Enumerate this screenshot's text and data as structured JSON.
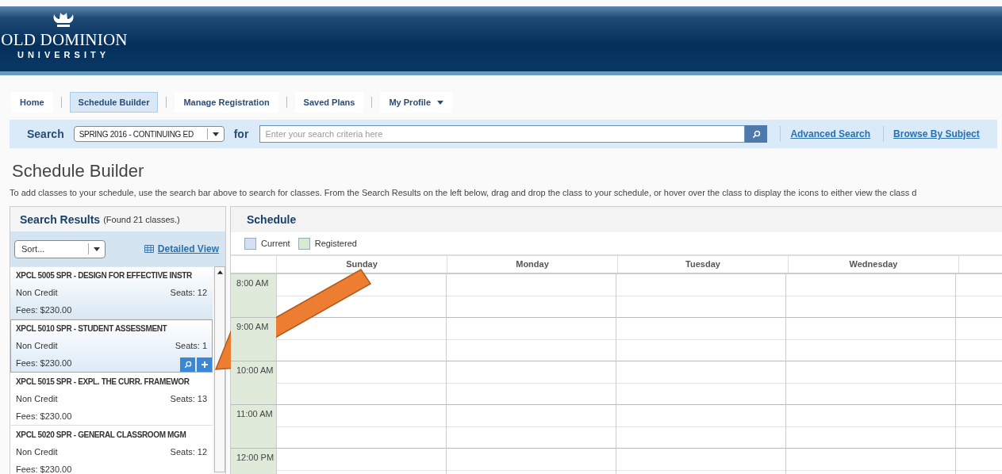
{
  "header": {
    "logo_line1": "OLD DOMINION",
    "logo_line2": "UNIVERSITY"
  },
  "nav": [
    {
      "label": "Home",
      "selected": false
    },
    {
      "label": "Schedule Builder",
      "selected": true
    },
    {
      "label": "Manage Registration",
      "selected": false
    },
    {
      "label": "Saved Plans",
      "selected": false
    },
    {
      "label": "My Profile",
      "selected": false,
      "dropdown": true
    }
  ],
  "search_bar": {
    "label": "Search",
    "term": "SPRING 2016 - CONTINUING ED",
    "for_label": "for",
    "placeholder": "Enter your search criteria here",
    "links": [
      "Advanced Search",
      "Browse By Subject"
    ]
  },
  "page": {
    "title": "Schedule Builder",
    "description": "To add classes to your schedule, use the search bar above to search for classes.  From the Search Results on the left below, drag and drop the class to your schedule, or hover over the class to display the icons to either view the class d"
  },
  "search_results": {
    "title": "Search Results",
    "count": "(Found 21 classes.)",
    "sort": "Sort...",
    "view_link": "Detailed View",
    "classes": [
      {
        "title": "XPCL 5005 SPR - DESIGN FOR EFFECTIVE INSTR",
        "credit": "Non Credit",
        "seats": "Seats: 12",
        "fees": "Fees: $230.00",
        "selected": false,
        "shaded": true
      },
      {
        "title": "XPCL 5010 SPR - STUDENT ASSESSMENT",
        "credit": "Non Credit",
        "seats": "Seats: 1",
        "fees": "Fees: $230.00",
        "selected": true,
        "shaded": false
      },
      {
        "title": "XPCL 5015 SPR - EXPL. THE CURR. FRAMEWOR",
        "credit": "Non Credit",
        "seats": "Seats: 13",
        "fees": "Fees: $230.00",
        "selected": false,
        "shaded": false
      },
      {
        "title": "XPCL 5020 SPR - GENERAL CLASSROOM MGM",
        "credit": "Non Credit",
        "seats": "Seats: 12",
        "fees": "Fees: $230.00",
        "selected": false,
        "shaded": false
      }
    ]
  },
  "schedule": {
    "title": "Schedule",
    "legend": [
      {
        "label": "Current",
        "color": "#d3e0f5"
      },
      {
        "label": "Registered",
        "color": "#d8ebcf"
      }
    ],
    "days": [
      "Sunday",
      "Monday",
      "Tuesday",
      "Wednesday"
    ],
    "times": [
      "8:00 AM",
      "9:00 AM",
      "10:00 AM",
      "11:00 AM",
      "12:00 PM"
    ]
  }
}
